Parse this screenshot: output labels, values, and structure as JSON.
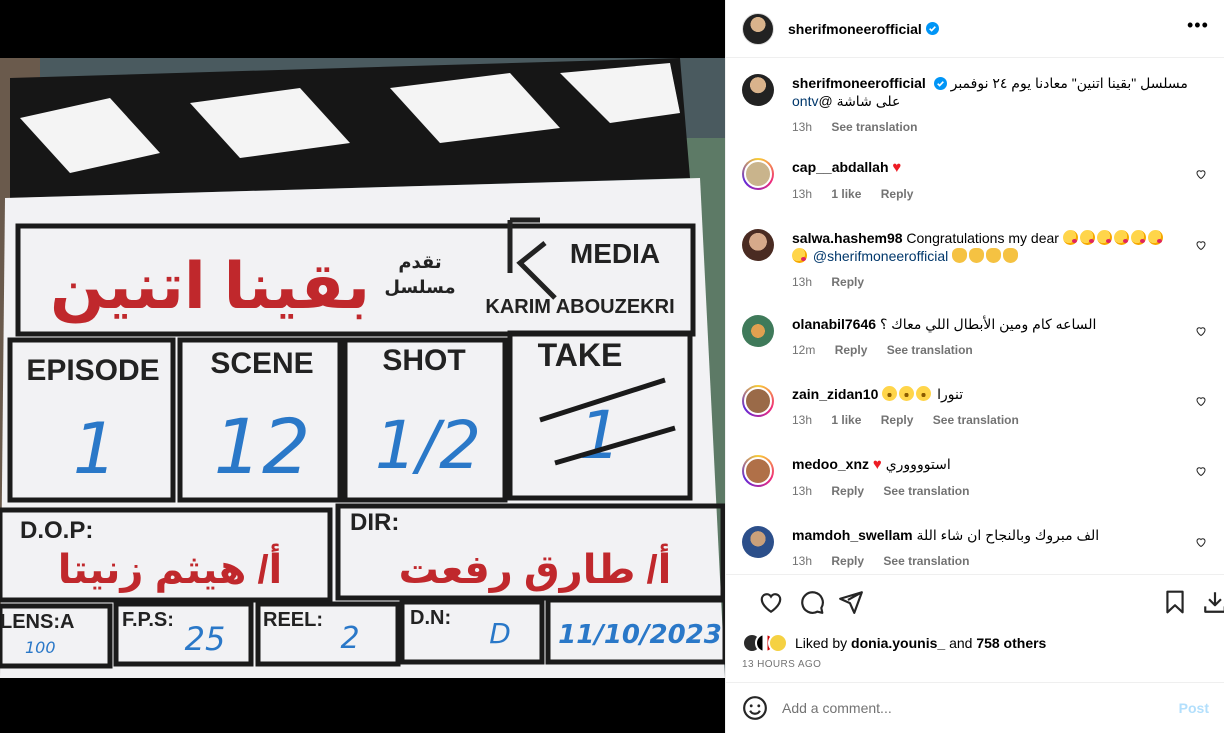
{
  "post": {
    "author": "sherifmoneerofficial",
    "caption_line1": "مسلسل \"بقينا اتنين\" معادنا يوم ٢٤ نوفمبر",
    "caption_line2_prefix": "على شاشة @",
    "caption_mention": "ontv",
    "caption_time": "13h",
    "see_translation": "See translation"
  },
  "clapper": {
    "title_ar": "بقينا اتنين",
    "presents_ar_1": "تقدم",
    "presents_ar_2": "مسلسل",
    "media_brand": "MEDIA",
    "producer": "KARIM ABOUZEKRI",
    "col_episode": "EPISODE",
    "col_scene": "SCENE",
    "col_shot": "SHOT",
    "col_take": "TAKE",
    "val_episode": "1",
    "val_scene": "12",
    "val_shot": "1/2",
    "val_take": "1",
    "dop_label": "D.O.P:",
    "dop_name": "أ/ هيثم زنيتا",
    "dir_label": "DIR:",
    "dir_name": "أ/ طارق رفعت",
    "lens_label": "LENS:A",
    "fps_label": "F.P.S:",
    "fps_val": "25",
    "reel_label": "REEL:",
    "reel_val": "2",
    "dn_label": "D.N:",
    "dn_val": "D",
    "date_val": "11/10/2023",
    "lens_val": "100"
  },
  "comments": [
    {
      "user": "cap__abdallah",
      "text": "",
      "heart": true,
      "time": "13h",
      "likes": "1 like",
      "reply": "Reply",
      "translate": ""
    },
    {
      "user": "salwa.hashem98",
      "text": "Congratulations my dear",
      "mention": "@sherifmoneerofficial",
      "time": "13h",
      "likes": "",
      "reply": "Reply",
      "translate": ""
    },
    {
      "user": "olanabil7646",
      "text": "الساعه كام ومين الأبطال اللي معاك ؟",
      "time": "12m",
      "likes": "",
      "reply": "Reply",
      "translate": "See translation"
    },
    {
      "user": "zain_zidan10",
      "text": "تنورا",
      "time": "13h",
      "likes": "1 like",
      "reply": "Reply",
      "translate": "See translation"
    },
    {
      "user": "medoo_xnz",
      "text": "استووووري",
      "heart": true,
      "time": "13h",
      "likes": "",
      "reply": "Reply",
      "translate": "See translation"
    },
    {
      "user": "mamdoh_swellam",
      "text": "الف مبروك وبالنجاح ان شاء اللة",
      "time": "13h",
      "likes": "",
      "reply": "Reply",
      "translate": "See translation"
    }
  ],
  "likes": {
    "prefix": "Liked by",
    "user": "donia.younis_",
    "middle": "and",
    "others": "758 others"
  },
  "posted_ago": "13 HOURS AGO",
  "add_comment": {
    "placeholder": "Add a comment...",
    "post_label": "Post"
  },
  "colors": {
    "accent_blue": "#0095f6",
    "post_disabled": "#b2dffc",
    "muted": "#737373",
    "heart_red": "#ed1c24"
  }
}
